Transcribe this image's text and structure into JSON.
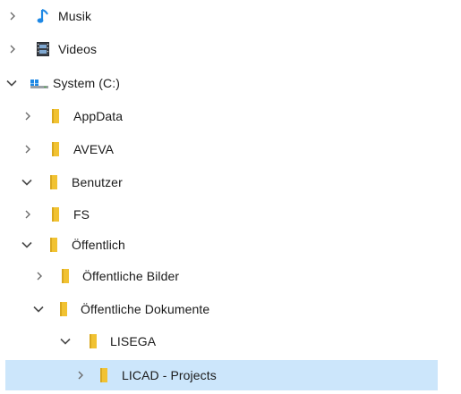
{
  "tree": {
    "items": [
      {
        "label": "Musik",
        "icon": "music-note-icon",
        "expanded": false
      },
      {
        "label": "Videos",
        "icon": "video-film-icon",
        "expanded": false
      },
      {
        "label": "System (C:)",
        "icon": "drive-icon",
        "expanded": true
      },
      {
        "label": "AppData",
        "icon": "folder-icon",
        "expanded": false
      },
      {
        "label": "AVEVA",
        "icon": "folder-icon",
        "expanded": false
      },
      {
        "label": "Benutzer",
        "icon": "folder-icon",
        "expanded": true
      },
      {
        "label": "FS",
        "icon": "folder-icon",
        "expanded": false
      },
      {
        "label": "Öffentlich",
        "icon": "folder-icon",
        "expanded": true
      },
      {
        "label": "Öffentliche Bilder",
        "icon": "folder-icon",
        "expanded": false
      },
      {
        "label": "Öffentliche Dokumente",
        "icon": "folder-icon",
        "expanded": true
      },
      {
        "label": "LISEGA",
        "icon": "folder-icon",
        "expanded": true
      },
      {
        "label": "LICAD - Projects",
        "icon": "folder-icon",
        "expanded": false,
        "selected": true
      }
    ]
  },
  "colors": {
    "selection": "#cce6fb",
    "folder": "#f1c232",
    "music": "#1e88e5",
    "chevron": "#6b6b6b"
  }
}
